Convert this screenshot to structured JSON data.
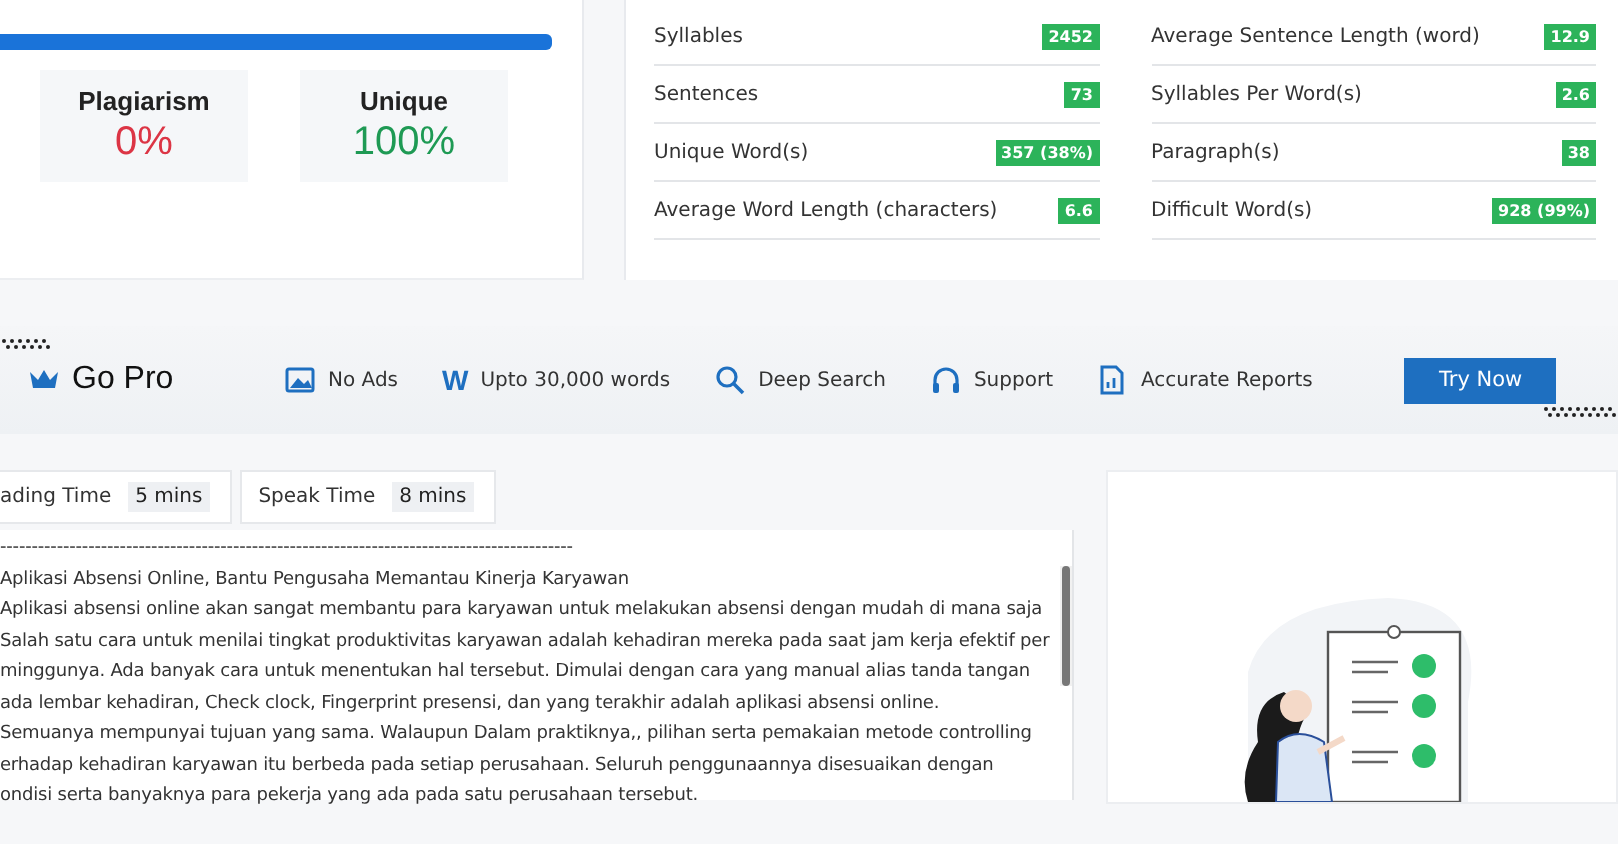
{
  "progress": {
    "level": 1
  },
  "scores": [
    {
      "label": "Plagiarism",
      "value": "0%",
      "kind": "plagiarism"
    },
    {
      "label": "Unique",
      "value": "100%",
      "kind": "unique"
    }
  ],
  "stats": [
    [
      {
        "label": "Syllables",
        "value": "2452"
      },
      {
        "label": "Sentences",
        "value": "73"
      },
      {
        "label": "Unique Word(s)",
        "value": "357 (38%)"
      },
      {
        "label": "Average Word Length (characters)",
        "value": "6.6"
      }
    ],
    [
      {
        "label": "Average Sentence Length (word)",
        "value": "12.9"
      },
      {
        "label": "Syllables Per Word(s)",
        "value": "2.6"
      },
      {
        "label": "Paragraph(s)",
        "value": "38"
      },
      {
        "label": "Difficult Word(s)",
        "value": "928 (99%)"
      }
    ]
  ],
  "go_pro": {
    "title": "Go Pro",
    "features": [
      {
        "kind": "image",
        "label": "No Ads"
      },
      {
        "kind": "letter",
        "icon_text": "W",
        "label": "Upto 30,000 words"
      },
      {
        "kind": "search",
        "label": "Deep Search"
      },
      {
        "kind": "headset",
        "label": "Support"
      },
      {
        "kind": "report",
        "label": "Accurate Reports"
      }
    ],
    "button": "Try Now"
  },
  "times": [
    {
      "label": "ading Time",
      "value": "5 mins"
    },
    {
      "label": "Speak Time",
      "value": "8 mins"
    }
  ],
  "text_lines": [
    "-------------------------------------------------------------------------------------------",
    "Aplikasi Absensi Online, Bantu Pengusaha Memantau Kinerja Karyawan",
    "Aplikasi absensi online akan sangat membantu para karyawan untuk melakukan absensi dengan mudah di mana saja",
    "Salah satu cara untuk menilai tingkat produktivitas karyawan adalah kehadiran mereka pada saat jam kerja efektif per",
    "minggunya. Ada banyak cara untuk menentukan hal tersebut. Dimulai dengan cara yang manual alias tanda tangan",
    "ada lembar kehadiran, Check clock, Fingerprint presensi, dan yang terakhir adalah aplikasi absensi online.",
    "Semuanya mempunyai tujuan yang sama. Walaupun Dalam praktiknya,, pilihan serta pemakaian metode controlling",
    "erhadap kehadiran karyawan itu berbeda pada setiap perusahaan. Seluruh penggunaannya disesuaikan dengan",
    "ondisi serta banyaknya para pekerja yang ada pada satu perusahaan tersebut."
  ]
}
